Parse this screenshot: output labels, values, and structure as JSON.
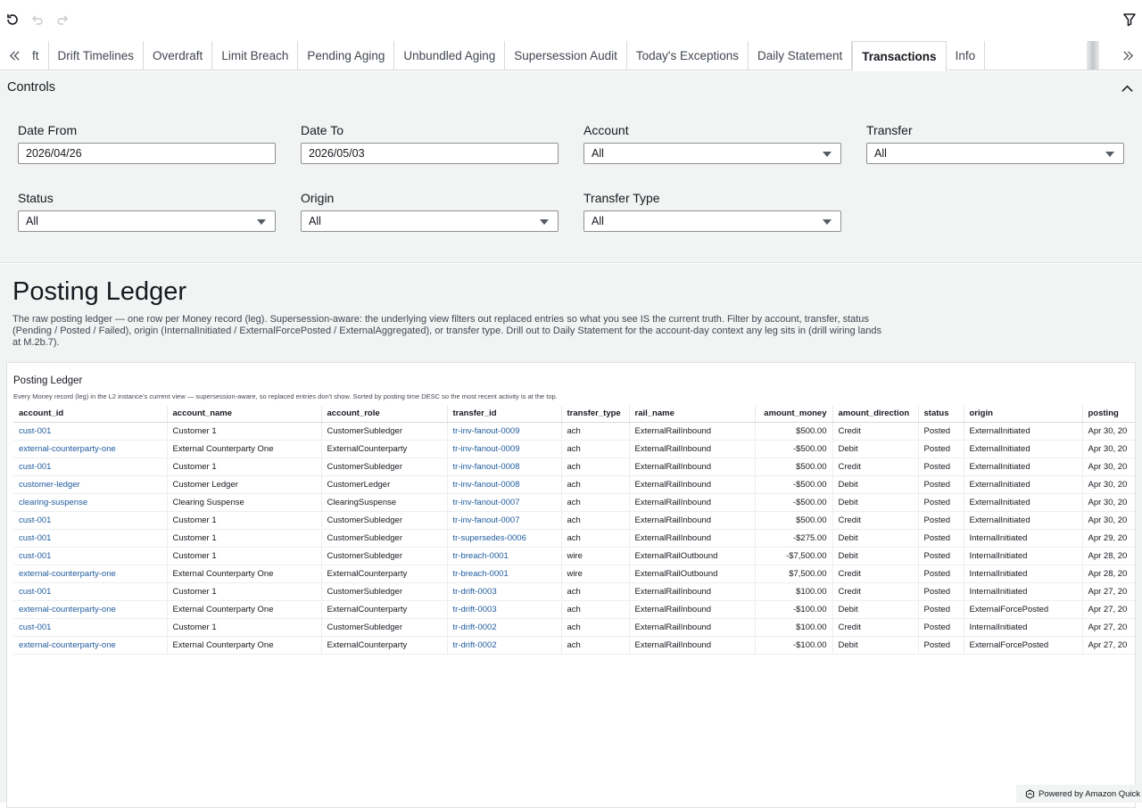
{
  "toolbar": {
    "reset_icon": "reset-icon",
    "undo_icon": "undo-icon",
    "redo_icon": "redo-icon",
    "filter_icon": "filter-icon"
  },
  "tabs": [
    {
      "label": "ft"
    },
    {
      "label": "Drift Timelines"
    },
    {
      "label": "Overdraft"
    },
    {
      "label": "Limit Breach"
    },
    {
      "label": "Pending Aging"
    },
    {
      "label": "Unbundled Aging"
    },
    {
      "label": "Supersession Audit"
    },
    {
      "label": "Today's Exceptions"
    },
    {
      "label": "Daily Statement"
    },
    {
      "label": "Transactions",
      "active": true
    },
    {
      "label": "Info"
    }
  ],
  "controls": {
    "title": "Controls",
    "date_from": {
      "label": "Date From",
      "value": "2026/04/26"
    },
    "date_to": {
      "label": "Date To",
      "value": "2026/05/03"
    },
    "account": {
      "label": "Account",
      "value": "All"
    },
    "transfer": {
      "label": "Transfer",
      "value": "All"
    },
    "status": {
      "label": "Status",
      "value": "All"
    },
    "origin": {
      "label": "Origin",
      "value": "All"
    },
    "transfer_type": {
      "label": "Transfer Type",
      "value": "All"
    }
  },
  "sheet": {
    "title": "Posting Ledger",
    "description": "The raw posting ledger — one row per Money record (leg). Supersession-aware: the underlying view filters out replaced entries so what you see IS the current truth. Filter by account, transfer, status (Pending / Posted / Failed), origin (InternalInitiated / ExternalForcePosted / ExternalAggregated), or transfer type. Drill out to Daily Statement for the account-day context any leg sits in (drill wiring lands at M.2b.7)."
  },
  "visual": {
    "title": "Posting Ledger",
    "subtitle": "Every Money record (leg) in the L2 instance's current view — supersession-aware, so replaced entries don't show. Sorted by posting time DESC so the most recent activity is at the top.",
    "columns": [
      "account_id",
      "account_name",
      "account_role",
      "transfer_id",
      "transfer_type",
      "rail_name",
      "amount_money",
      "amount_direction",
      "status",
      "origin",
      "posting"
    ],
    "rows": [
      [
        "cust-001",
        "Customer 1",
        "CustomerSubledger",
        "tr-inv-fanout-0009",
        "ach",
        "ExternalRailInbound",
        "$500.00",
        "Credit",
        "Posted",
        "ExternalInitiated",
        "Apr 30, 20"
      ],
      [
        "external-counterparty-one",
        "External Counterparty One",
        "ExternalCounterparty",
        "tr-inv-fanout-0009",
        "ach",
        "ExternalRailInbound",
        "-$500.00",
        "Debit",
        "Posted",
        "ExternalInitiated",
        "Apr 30, 20"
      ],
      [
        "cust-001",
        "Customer 1",
        "CustomerSubledger",
        "tr-inv-fanout-0008",
        "ach",
        "ExternalRailInbound",
        "$500.00",
        "Credit",
        "Posted",
        "ExternalInitiated",
        "Apr 30, 20"
      ],
      [
        "customer-ledger",
        "Customer Ledger",
        "CustomerLedger",
        "tr-inv-fanout-0008",
        "ach",
        "ExternalRailInbound",
        "-$500.00",
        "Debit",
        "Posted",
        "ExternalInitiated",
        "Apr 30, 20"
      ],
      [
        "clearing-suspense",
        "Clearing Suspense",
        "ClearingSuspense",
        "tr-inv-fanout-0007",
        "ach",
        "ExternalRailInbound",
        "-$500.00",
        "Debit",
        "Posted",
        "ExternalInitiated",
        "Apr 30, 20"
      ],
      [
        "cust-001",
        "Customer 1",
        "CustomerSubledger",
        "tr-inv-fanout-0007",
        "ach",
        "ExternalRailInbound",
        "$500.00",
        "Credit",
        "Posted",
        "ExternalInitiated",
        "Apr 30, 20"
      ],
      [
        "cust-001",
        "Customer 1",
        "CustomerSubledger",
        "tr-supersedes-0006",
        "ach",
        "ExternalRailInbound",
        "-$275.00",
        "Debit",
        "Posted",
        "InternalInitiated",
        "Apr 29, 20"
      ],
      [
        "cust-001",
        "Customer 1",
        "CustomerSubledger",
        "tr-breach-0001",
        "wire",
        "ExternalRailOutbound",
        "-$7,500.00",
        "Debit",
        "Posted",
        "InternalInitiated",
        "Apr 28, 20"
      ],
      [
        "external-counterparty-one",
        "External Counterparty One",
        "ExternalCounterparty",
        "tr-breach-0001",
        "wire",
        "ExternalRailOutbound",
        "$7,500.00",
        "Credit",
        "Posted",
        "InternalInitiated",
        "Apr 28, 20"
      ],
      [
        "cust-001",
        "Customer 1",
        "CustomerSubledger",
        "tr-drift-0003",
        "ach",
        "ExternalRailInbound",
        "$100.00",
        "Credit",
        "Posted",
        "InternalInitiated",
        "Apr 27, 20"
      ],
      [
        "external-counterparty-one",
        "External Counterparty One",
        "ExternalCounterparty",
        "tr-drift-0003",
        "ach",
        "ExternalRailInbound",
        "-$100.00",
        "Debit",
        "Posted",
        "ExternalForcePosted",
        "Apr 27, 20"
      ],
      [
        "cust-001",
        "Customer 1",
        "CustomerSubledger",
        "tr-drift-0002",
        "ach",
        "ExternalRailInbound",
        "$100.00",
        "Credit",
        "Posted",
        "InternalInitiated",
        "Apr 27, 20"
      ],
      [
        "external-counterparty-one",
        "External Counterparty One",
        "ExternalCounterparty",
        "tr-drift-0002",
        "ach",
        "ExternalRailInbound",
        "-$100.00",
        "Debit",
        "Posted",
        "ExternalForcePosted",
        "Apr 27, 20"
      ]
    ]
  },
  "footer": {
    "powered_by": "Powered by Amazon Quick"
  },
  "colors": {
    "link": "#1f5b9e",
    "background": "#f2f3f3"
  }
}
